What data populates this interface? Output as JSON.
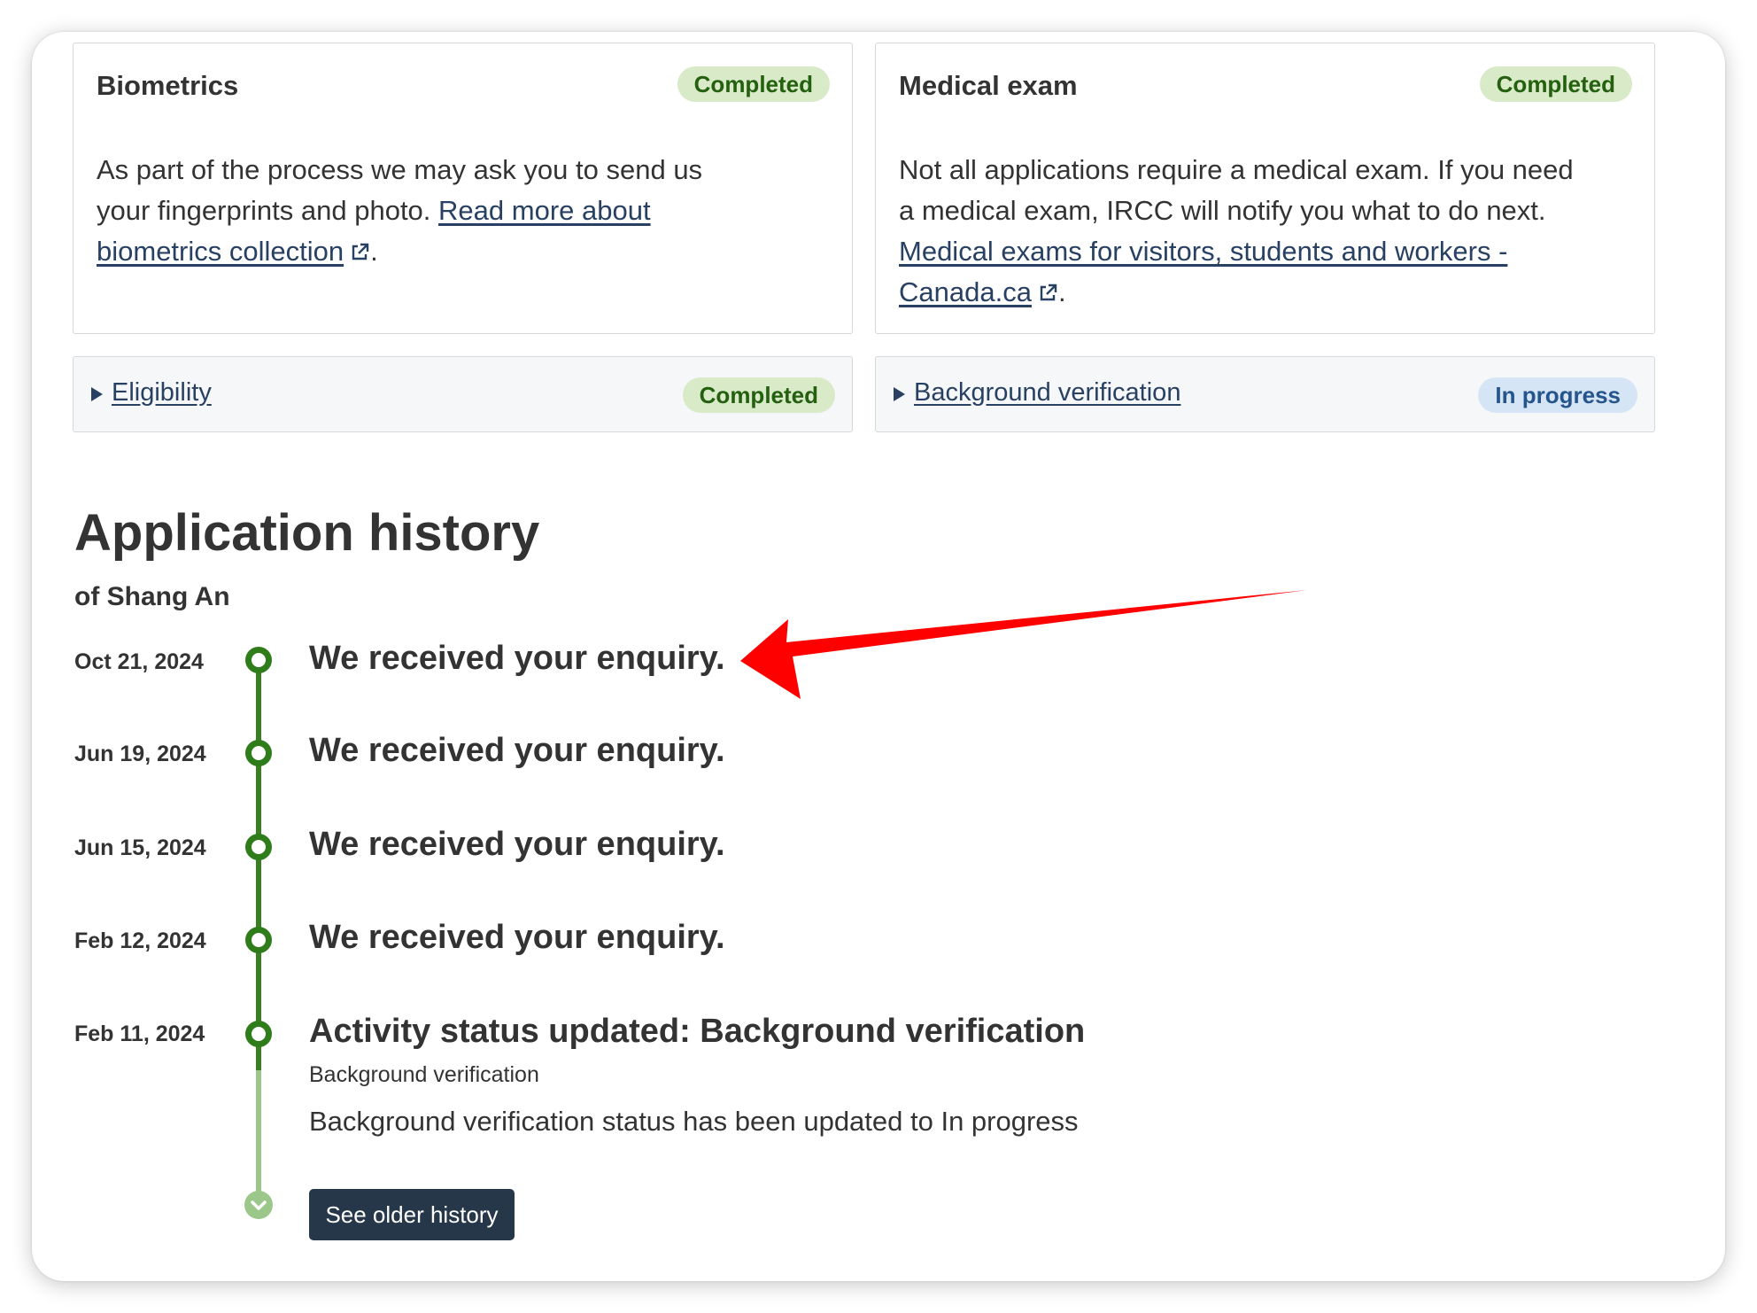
{
  "cards": [
    {
      "title": "Biometrics",
      "status": "Completed",
      "body_text": "As part of the process we may ask you to send us your fingerprints and photo. ",
      "link_text": "Read more about biometrics collection",
      "trailing": "."
    },
    {
      "title": "Medical exam",
      "status": "Completed",
      "body_text": "Not all applications require a medical exam. If you need a medical exam, IRCC will notify you what to do next. ",
      "link_text": "Medical exams for visitors, students and workers - Canada.ca",
      "trailing": "."
    }
  ],
  "summaries": [
    {
      "label": "Eligibility",
      "status": "Completed"
    },
    {
      "label": "Background verification",
      "status": "In progress"
    }
  ],
  "history": {
    "title": "Application history",
    "subtitle": "of Shang An",
    "events": [
      {
        "date": "Oct 21, 2024",
        "title": "We received your enquiry."
      },
      {
        "date": "Jun 19, 2024",
        "title": "We received your enquiry."
      },
      {
        "date": "Jun 15, 2024",
        "title": "We received your enquiry."
      },
      {
        "date": "Feb 12, 2024",
        "title": "We received your enquiry."
      },
      {
        "date": "Feb 11, 2024",
        "title": "Activity status updated: Background verification",
        "subtitle": "Background verification",
        "description": "Background verification status has been updated to In progress"
      }
    ],
    "older_button": "See older history"
  },
  "colors": {
    "completed_bg": "#d8eac8",
    "completed_text": "#24600f",
    "in_progress_bg": "#d5e5f6",
    "in_progress_text": "#26558c",
    "timeline_green": "#3a7f22",
    "link": "#284162",
    "button": "#26374a",
    "annotation_arrow": "#ff0000"
  },
  "icons": {
    "external_link": "external-link-icon",
    "expand": "triangle-right-icon",
    "timeline_node": "circle-node-icon",
    "timeline_end": "chevron-down-icon"
  }
}
